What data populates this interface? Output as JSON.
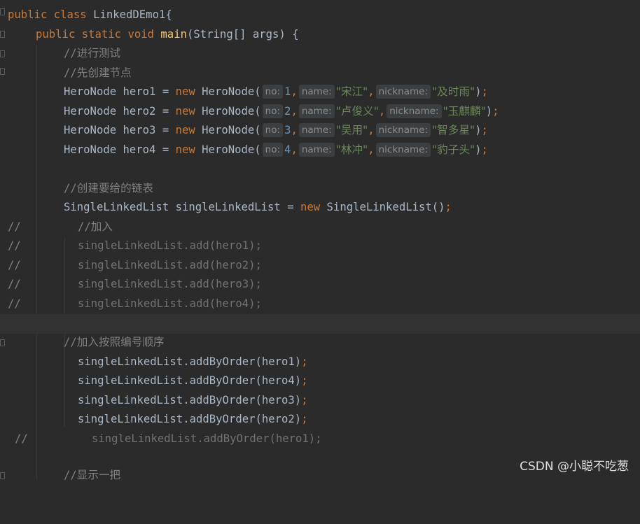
{
  "editor": {
    "line1": {
      "kw1": "public",
      "kw2": "class",
      "name": "LinkedDEmo1{"
    },
    "line2": {
      "kw1": "public",
      "kw2": "static",
      "kw3": "void",
      "fn": "main",
      "rest": "(String[] args) {"
    },
    "line3": {
      "comment": "//进行测试"
    },
    "line4": {
      "comment": "//先创建节点"
    },
    "heroes": [
      {
        "decl": "HeroNode hero1 = ",
        "kw_new": "new",
        "ctor": " HeroNode(",
        "hint_no": "no:",
        "no": "1",
        "hint_name": "name:",
        "name": "\"宋江\"",
        "hint_nick": "nickname:",
        "nick": "\"及时雨\"",
        "close": ")",
        "semi": ";"
      },
      {
        "decl": "HeroNode hero2 = ",
        "kw_new": "new",
        "ctor": " HeroNode(",
        "hint_no": "no:",
        "no": "2",
        "hint_name": "name:",
        "name": "\"卢俊义\"",
        "hint_nick": "nickname:",
        "nick": "\"玉麒麟\"",
        "close": ")",
        "semi": ";"
      },
      {
        "decl": "HeroNode hero3 = ",
        "kw_new": "new",
        "ctor": " HeroNode(",
        "hint_no": "no:",
        "no": "3",
        "hint_name": "name:",
        "name": "\"吴用\"",
        "hint_nick": "nickname:",
        "nick": "\"智多星\"",
        "close": ")",
        "semi": ";"
      },
      {
        "decl": "HeroNode hero4 = ",
        "kw_new": "new",
        "ctor": " HeroNode(",
        "hint_no": "no:",
        "no": "4",
        "hint_name": "name:",
        "name": "\"林冲\"",
        "hint_nick": "nickname:",
        "nick": "\"豹子头\"",
        "close": ")",
        "semi": ";"
      }
    ],
    "line10": {
      "comment": "//创建要给的链表"
    },
    "line11": {
      "decl": "SingleLinkedList singleLinkedList = ",
      "kw_new": "new",
      "ctor": " SingleLinkedList()",
      "semi": ";"
    },
    "commented_block": [
      {
        "prefix": "//",
        "text": "//加入"
      },
      {
        "prefix": "//",
        "text": "singleLinkedList.add(hero1);"
      },
      {
        "prefix": "//",
        "text": "singleLinkedList.add(hero2);"
      },
      {
        "prefix": "//",
        "text": "singleLinkedList.add(hero3);"
      },
      {
        "prefix": "//",
        "text": "singleLinkedList.add(hero4);"
      }
    ],
    "line18": {
      "comment": "//加入按照编号顺序"
    },
    "add_by_order": [
      {
        "text": "singleLinkedList.addByOrder(hero1)",
        "semi": ";"
      },
      {
        "text": "singleLinkedList.addByOrder(hero4)",
        "semi": ";"
      },
      {
        "text": "singleLinkedList.addByOrder(hero3)",
        "semi": ";"
      },
      {
        "text": "singleLinkedList.addByOrder(hero2)",
        "semi": ";"
      }
    ],
    "line23": {
      "prefix": "//",
      "text": "singleLinkedList.addByOrder(hero1);"
    },
    "line25": {
      "comment": "//显示一把"
    }
  },
  "watermark": "CSDN @小聪不吃葱"
}
